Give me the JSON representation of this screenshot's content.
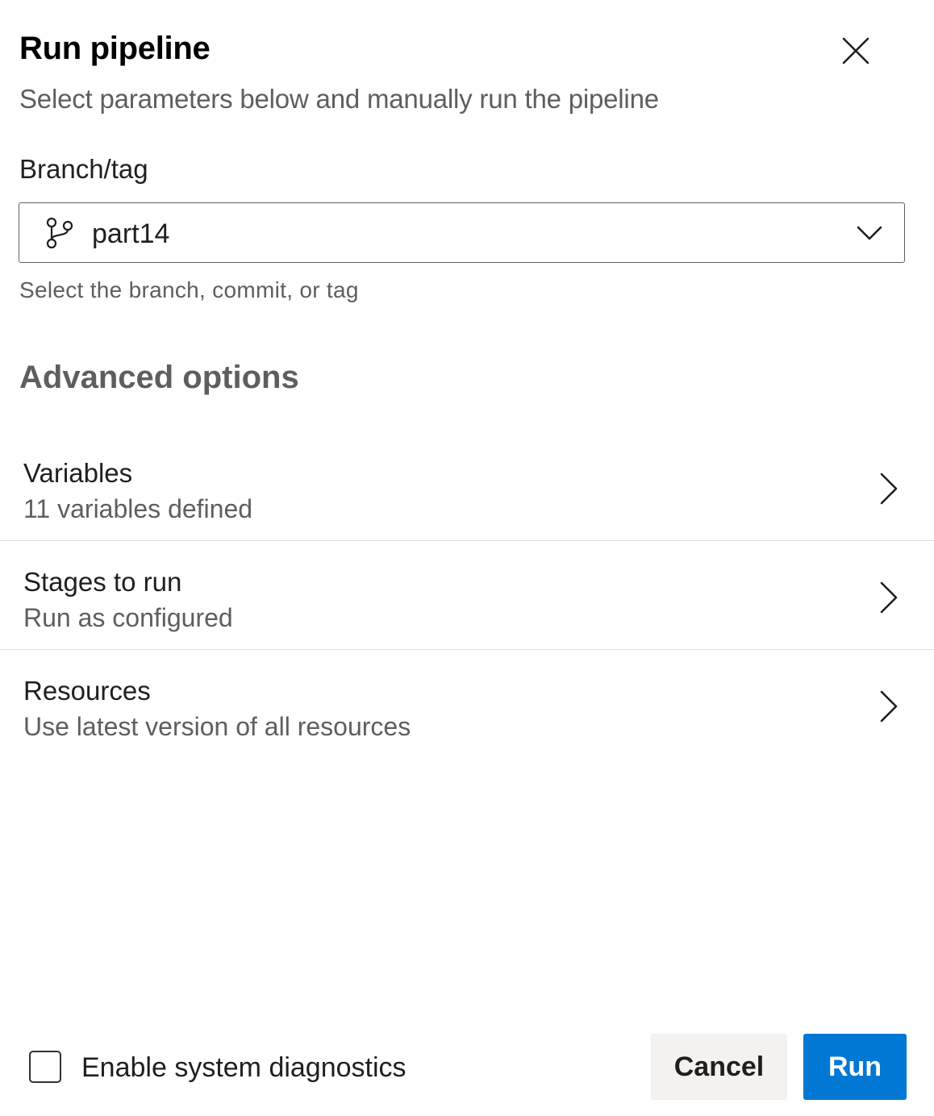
{
  "dialog": {
    "title": "Run pipeline",
    "subtitle": "Select parameters below and manually run the pipeline",
    "close_icon": "close-icon"
  },
  "branch": {
    "label": "Branch/tag",
    "value": "part14",
    "icon": "git-branch-icon",
    "dropdown_icon": "chevron-down-icon",
    "helper": "Select the branch, commit, or tag"
  },
  "advanced": {
    "title": "Advanced options",
    "items": [
      {
        "title": "Variables",
        "subtitle": "11 variables defined",
        "icon": "chevron-right-icon"
      },
      {
        "title": "Stages to run",
        "subtitle": "Run as configured",
        "icon": "chevron-right-icon"
      },
      {
        "title": "Resources",
        "subtitle": "Use latest version of all resources",
        "icon": "chevron-right-icon"
      }
    ]
  },
  "footer": {
    "diagnostics_label": "Enable system diagnostics",
    "diagnostics_checked": false,
    "cancel_label": "Cancel",
    "run_label": "Run"
  },
  "colors": {
    "primary": "#0078d4",
    "secondary_button": "#f3f2f1",
    "muted_text": "#605e5c",
    "divider": "#e1dfdd"
  }
}
